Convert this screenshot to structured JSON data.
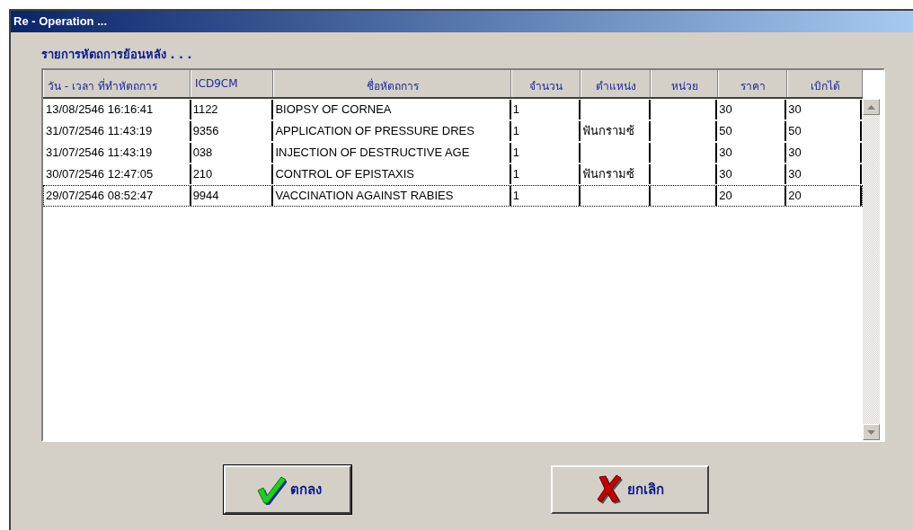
{
  "window": {
    "title": "Re - Operation ..."
  },
  "section_title": "รายการหัตถการย้อนหลัง . . .",
  "table": {
    "columns": [
      "วัน - เวลา ที่ทำหัตถการ",
      "ICD9CM",
      "ชื่อหัตถการ",
      "จำนวน",
      "ตำแหน่ง",
      "หน่วย",
      "ราคา",
      "เบิกได้"
    ],
    "rows": [
      {
        "cells": [
          "13/08/2546  16:16:41",
          "1122",
          "BIOPSY OF CORNEA",
          "1",
          "",
          "",
          "30",
          "30"
        ],
        "selected": false
      },
      {
        "cells": [
          "31/07/2546  11:43:19",
          "9356",
          "APPLICATION OF PRESSURE DRES",
          "1",
          "ฟันกรามซ้",
          "",
          "50",
          "50"
        ],
        "selected": false
      },
      {
        "cells": [
          "31/07/2546  11:43:19",
          "038",
          "INJECTION OF DESTRUCTIVE AGE",
          "1",
          "",
          "",
          "30",
          "30"
        ],
        "selected": false
      },
      {
        "cells": [
          "30/07/2546  12:47:05",
          "210",
          "CONTROL OF EPISTAXIS",
          "1",
          "ฟันกรามซ้",
          "",
          "30",
          "30"
        ],
        "selected": false
      },
      {
        "cells": [
          "29/07/2546  08:52:47",
          "9944",
          "VACCINATION AGAINST RABIES",
          "1",
          "",
          "",
          "20",
          "20"
        ],
        "selected": true
      }
    ]
  },
  "buttons": [
    {
      "kind": "ok",
      "label": "ตกลง"
    },
    {
      "kind": "cancel",
      "label": "ยกเลิก"
    }
  ]
}
